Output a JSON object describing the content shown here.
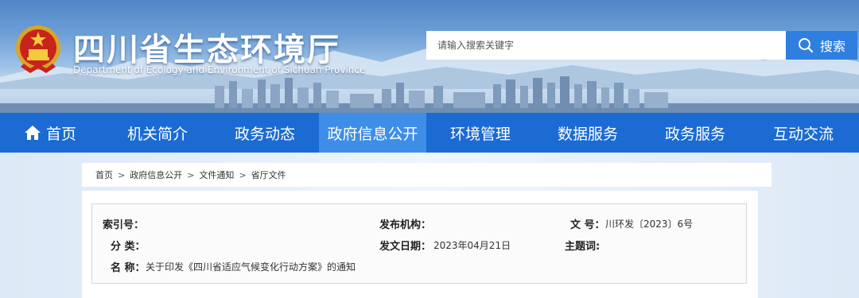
{
  "header": {
    "title": "四川省生态环境厅",
    "subtitle": "Department of Ecology and Environment of Sichuan Province",
    "search": {
      "placeholder": "请输入搜索关键字",
      "button_label": "搜索"
    }
  },
  "nav": {
    "items": [
      {
        "label": "首页",
        "icon": "home-icon"
      },
      {
        "label": "机关简介"
      },
      {
        "label": "政务动态"
      },
      {
        "label": "政府信息公开",
        "active": true
      },
      {
        "label": "环境管理"
      },
      {
        "label": "数据服务"
      },
      {
        "label": "政务服务"
      },
      {
        "label": "互动交流"
      }
    ]
  },
  "breadcrumb": [
    "首页",
    "政府信息公开",
    "文件通知",
    "省厅文件"
  ],
  "breadcrumb_separator": ">",
  "info": {
    "index_no": {
      "label": "索引号：",
      "value": ""
    },
    "publisher": {
      "label": "发布机构：",
      "value": ""
    },
    "doc_no": {
      "label": "文 号：",
      "value": "川环发〔2023〕6号"
    },
    "category": {
      "label": "分 类：",
      "value": ""
    },
    "pub_date": {
      "label": "发文日期：",
      "value": "2023年04月21日"
    },
    "subject": {
      "label": "主题词:",
      "value": ""
    },
    "name": {
      "label": "名 称：",
      "value": "关于印发《四川省适应气候变化行动方案》的通知"
    }
  },
  "colors": {
    "nav_bg": "#1b6bd2",
    "nav_active": "#3e8ee8",
    "search_button": "#2f7fe0"
  }
}
